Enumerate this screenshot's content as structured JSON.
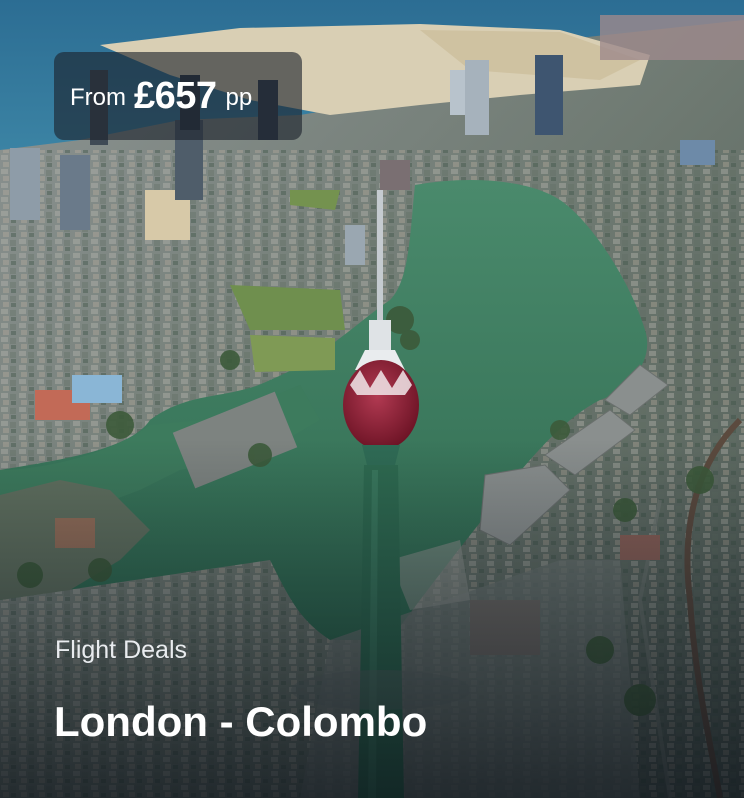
{
  "deal": {
    "price": {
      "from_label": "From",
      "amount": "£657",
      "unit": "pp"
    },
    "category": "Flight Deals",
    "route": "London - Colombo"
  },
  "image": {
    "subject": "aerial-city-photo"
  },
  "colors": {
    "badge_bg": "#1c222c",
    "text": "#ffffff",
    "water": "#3f7a5e",
    "sea": "#2a6a8f"
  }
}
